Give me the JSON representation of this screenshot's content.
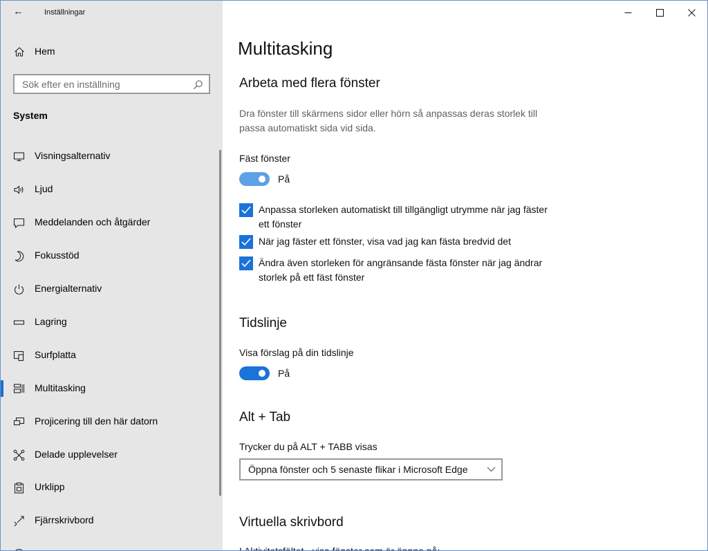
{
  "window": {
    "title": "Inställningar",
    "back_icon": "back-arrow-icon",
    "controls": [
      "minimize-icon",
      "maximize-icon",
      "close-icon"
    ]
  },
  "sidebar": {
    "home_label": "Hem",
    "search_placeholder": "Sök efter en inställning",
    "section": "System",
    "items": [
      {
        "label": "Visningsalternativ",
        "icon": "monitor-icon"
      },
      {
        "label": "Ljud",
        "icon": "speaker-icon"
      },
      {
        "label": "Meddelanden och åtgärder",
        "icon": "message-icon"
      },
      {
        "label": "Fokusstöd",
        "icon": "moon-icon"
      },
      {
        "label": "Energialternativ",
        "icon": "power-icon"
      },
      {
        "label": "Lagring",
        "icon": "storage-icon"
      },
      {
        "label": "Surfplatta",
        "icon": "tablet-icon"
      },
      {
        "label": "Multitasking",
        "icon": "multitasking-icon",
        "selected": true
      },
      {
        "label": "Projicering till den här datorn",
        "icon": "projection-icon"
      },
      {
        "label": "Delade upplevelser",
        "icon": "shared-icon"
      },
      {
        "label": "Urklipp",
        "icon": "clipboard-icon"
      },
      {
        "label": "Fjärrskrivbord",
        "icon": "remote-desktop-icon"
      }
    ],
    "accent_color": "#1a6fd3"
  },
  "main": {
    "title": "Multitasking",
    "snap": {
      "heading": "Arbeta med flera fönster",
      "description": "Dra fönster till skärmens sidor eller hörn så anpassas deras storlek till passa automatiskt sida vid sida.",
      "toggle_title": "Fäst fönster",
      "toggle_state": "På",
      "toggle_color": "#5ea0e6",
      "checkboxes": [
        {
          "label": "Anpassa storleken automatiskt till tillgängligt utrymme när jag fäster ett fönster",
          "checked": true
        },
        {
          "label": "När jag fäster ett fönster, visa vad jag kan fästa bredvid det",
          "checked": true
        },
        {
          "label": "Ändra även storleken för angränsande fästa fönster när jag ändrar storlek på ett fäst fönster",
          "checked": true
        }
      ]
    },
    "timeline": {
      "heading": "Tidslinje",
      "toggle_title": "Visa förslag på din tidslinje",
      "toggle_state": "På",
      "toggle_color": "#1a73d9"
    },
    "alttab": {
      "heading": "Alt + Tab",
      "label": "Trycker du på ALT + TABB visas",
      "selected": "Öppna fönster och 5 senaste flikar i Microsoft Edge"
    },
    "virtual": {
      "heading": "Virtuella skrivbord",
      "cut_label": "I Aktivitetsfältet - visa fönster som är öppna på:"
    }
  }
}
